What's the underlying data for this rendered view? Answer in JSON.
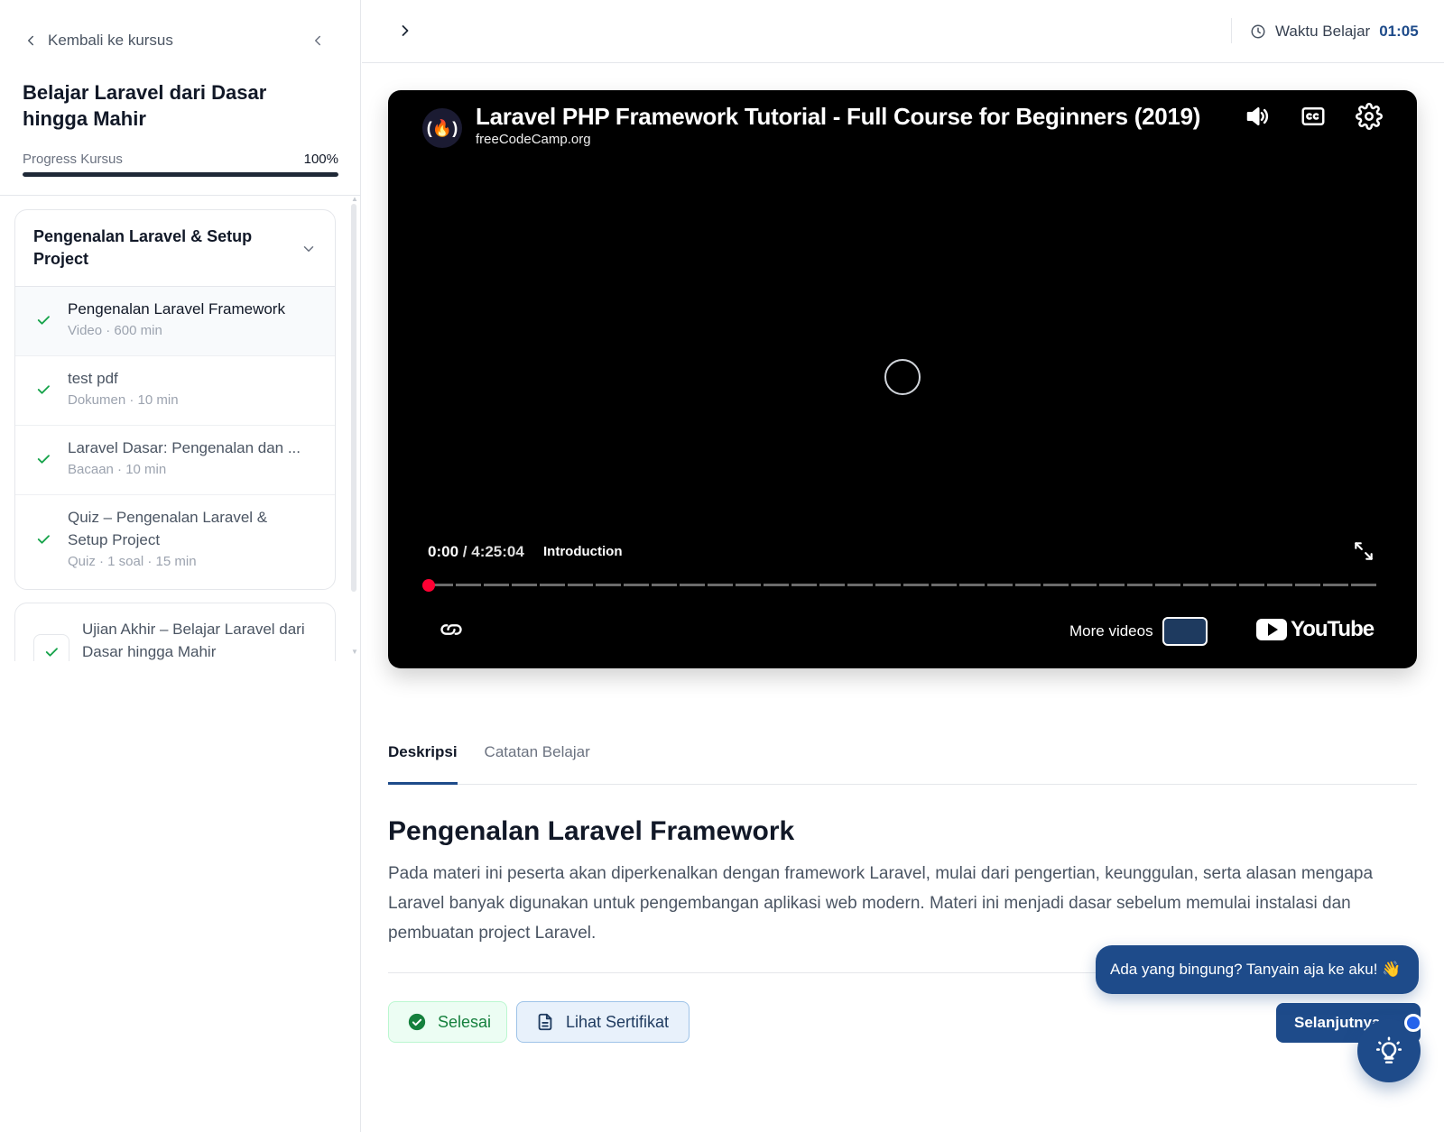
{
  "sidebar": {
    "back_label": "Kembali ke kursus",
    "course_title": "Belajar Laravel dari Dasar hingga Mahir",
    "progress_label": "Progress Kursus",
    "progress_text": "100%",
    "progress_value": 1.0,
    "module": {
      "title": "Pengenalan Laravel & Setup Project",
      "lessons": [
        {
          "title": "Pengenalan Laravel Framework",
          "meta": "Video · 600 min",
          "completed": true,
          "active": true
        },
        {
          "title": "test pdf",
          "meta": "Dokumen · 10 min",
          "completed": true,
          "active": false
        },
        {
          "title": "Laravel Dasar: Pengenalan dan ...",
          "meta": "Bacaan · 10 min",
          "completed": true,
          "active": false
        },
        {
          "title": "Quiz – Pengenalan Laravel & Setup Project",
          "meta": "Quiz · 1 soal · 15 min",
          "completed": true,
          "active": false
        }
      ]
    },
    "exam": {
      "title": "Ujian Akhir – Belajar Laravel dari Dasar hingga Mahir"
    }
  },
  "topbar": {
    "timer_label": "Waktu Belajar",
    "timer_value": "01:05"
  },
  "video": {
    "title": "Laravel PHP Framework Tutorial - Full Course for Beginners (2019)",
    "channel": "freeCodeCamp.org",
    "channel_logo": "(🔥)",
    "current_time": "0:00",
    "separator": "/",
    "duration": "4:25:04",
    "chapter": "Introduction",
    "more_videos_label": "More videos",
    "youtube_label": "YouTube",
    "icons": [
      "volume-icon",
      "captions-icon",
      "settings-icon",
      "fullscreen-icon",
      "link-icon"
    ]
  },
  "tabs": [
    {
      "label": "Deskripsi",
      "active": true
    },
    {
      "label": "Catatan Belajar",
      "active": false
    }
  ],
  "content": {
    "lesson_title": "Pengenalan Laravel Framework",
    "description": "Pada materi ini peserta akan diperkenalkan dengan framework Laravel, mulai dari pengertian, keunggulan, serta alasan mengapa Laravel banyak digunakan untuk pengembangan aplikasi web modern. Materi ini menjadi dasar sebelum memulai instalasi dan pembuatan project Laravel."
  },
  "actions": {
    "done_label": "Selesai",
    "certificate_label": "Lihat Sertifikat",
    "next_label": "Selanjutnya"
  },
  "assistant": {
    "bubble_text": "Ada yang bingung? Tanyain aja ke aku! 👋"
  },
  "colors": {
    "primary": "#1e4b8a",
    "success": "#16a34a",
    "video_bg": "#000000",
    "seek_dot": "#ff0033"
  }
}
